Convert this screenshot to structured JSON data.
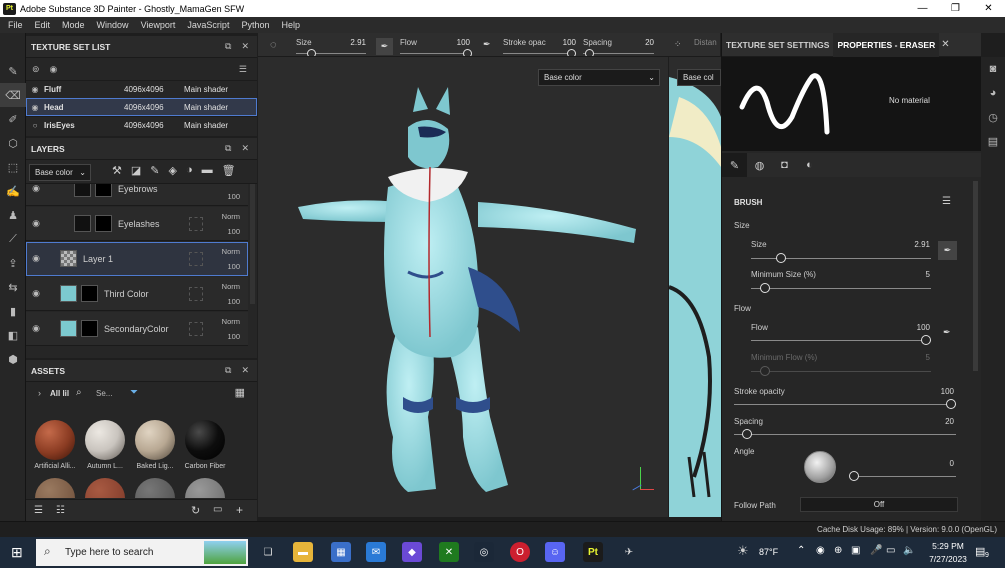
{
  "window": {
    "title": "Adobe Substance 3D Painter - Ghostly_MamaGen SFW",
    "app_icon_text": "Pt"
  },
  "menu": [
    "File",
    "Edit",
    "Mode",
    "Window",
    "Viewport",
    "JavaScript",
    "Python",
    "Help"
  ],
  "left_tools": [
    "paint-brush-icon",
    "eraser-icon",
    "projection-icon",
    "geometry-mask-icon",
    "picker-icon",
    "smudge-icon",
    "clone-icon",
    "material-picker-icon",
    "bake-icon",
    "transform-icon",
    "export-icon",
    "share-icon"
  ],
  "texture_set_list": {
    "title": "TEXTURE SET LIST",
    "rows": [
      {
        "name": "Fluff",
        "resolution": "4096x4096",
        "shader": "Main shader"
      },
      {
        "name": "Head",
        "resolution": "4096x4096",
        "shader": "Main shader"
      },
      {
        "name": "IrisEyes",
        "resolution": "4096x4096",
        "shader": "Main shader"
      }
    ]
  },
  "layers": {
    "title": "LAYERS",
    "channel": "Base color",
    "rows": [
      {
        "name": "Eyebrows",
        "blend": "",
        "opacity": "100"
      },
      {
        "name": "Eyelashes",
        "blend": "Norm",
        "opacity": "100"
      },
      {
        "name": "Layer 1",
        "blend": "Norm",
        "opacity": "100"
      },
      {
        "name": "Third Color",
        "blend": "Norm",
        "opacity": "100"
      },
      {
        "name": "SecondaryColor",
        "blend": "Norm",
        "opacity": "100"
      }
    ]
  },
  "assets": {
    "title": "ASSETS",
    "filter": "All lil",
    "search": "Se...",
    "items": [
      {
        "label": "Artificial Alli...",
        "color": "#8a3b22"
      },
      {
        "label": "Autumn L...",
        "color": "#c9c4be"
      },
      {
        "label": "Baked Lig...",
        "color": "#b8a893"
      },
      {
        "label": "Carbon Fiber",
        "color": "#0d0d0d"
      }
    ],
    "row2_colors": [
      "#6a4a36",
      "#7a3626",
      "#4a4a4a",
      "#666666"
    ]
  },
  "context_bar": {
    "size_label": "Size",
    "size_value": "2.91",
    "flow_label": "Flow",
    "flow_value": "100",
    "stroke_label": "Stroke opac",
    "stroke_value": "100",
    "spacing_label": "Spacing",
    "spacing_value": "20",
    "distance_label": "Distan"
  },
  "viewport": {
    "channel": "Base color",
    "channel2": "Base col"
  },
  "right_panel": {
    "tab1": "TEXTURE SET SETTINGS",
    "tab2": "PROPERTIES - ERASER",
    "no_material": "No material",
    "brush_header": "BRUSH",
    "size_group": "Size",
    "size_label": "Size",
    "size_value": "2.91",
    "min_size_label": "Minimum Size (%)",
    "min_size_value": "5",
    "flow_group": "Flow",
    "flow_label": "Flow",
    "flow_value": "100",
    "min_flow_label": "Minimum Flow (%)",
    "min_flow_value": "5",
    "stroke_label": "Stroke opacity",
    "stroke_value": "100",
    "spacing_label": "Spacing",
    "spacing_value": "20",
    "angle_label": "Angle",
    "angle_value": "0",
    "follow_label": "Follow Path",
    "follow_value": "Off"
  },
  "status": {
    "text": "Cache Disk Usage:  89% | Version: 9.0.0 (OpenGL)"
  },
  "taskbar": {
    "search_placeholder": "Type here to search",
    "weather": "87°F",
    "time": "5:29 PM",
    "date": "7/27/2023",
    "notification_count": "9"
  }
}
